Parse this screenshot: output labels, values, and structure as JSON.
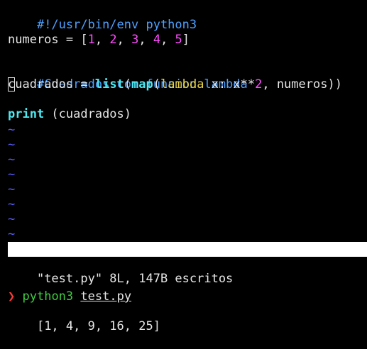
{
  "editor": {
    "lines": {
      "shebang": "#!/usr/bin/env python3",
      "numeros": {
        "name": "numeros",
        "eq": " = [",
        "n1": "1",
        "n2": "2",
        "n3": "3",
        "n4": "4",
        "n5": "5",
        "sep": ", ",
        "close": "]"
      },
      "comment": "#Cuadrados con funcion lambda",
      "cuadrados": {
        "cursor": "c",
        "rest": "uadrados = ",
        "list": "list",
        "paren1": "(",
        "map": "map",
        "paren2": "(",
        "lambda": "lambda",
        "mid": " x: x**",
        "two": "2",
        "tail": ", numeros))"
      },
      "print": {
        "kw": "print",
        "args": " (cuadrados)"
      }
    },
    "empty_marker": "~",
    "status": {
      "filename": "test.py",
      "message": "\"test.py\" 8L, 147B escritos"
    }
  },
  "shell": {
    "prompt_symbol": "❯",
    "command": "python3",
    "argument": "test.py",
    "output": "[1, 4, 9, 16, 25]"
  },
  "colors": {
    "comment": "#4ea0ff",
    "number": "#ff4dff",
    "builtin": "#4ee8f0",
    "keyword_lambda": "#e6d34a",
    "tilde": "#5a5cff",
    "prompt_arrow": "#ff3a3a",
    "prompt_command": "#3ecf3e"
  }
}
